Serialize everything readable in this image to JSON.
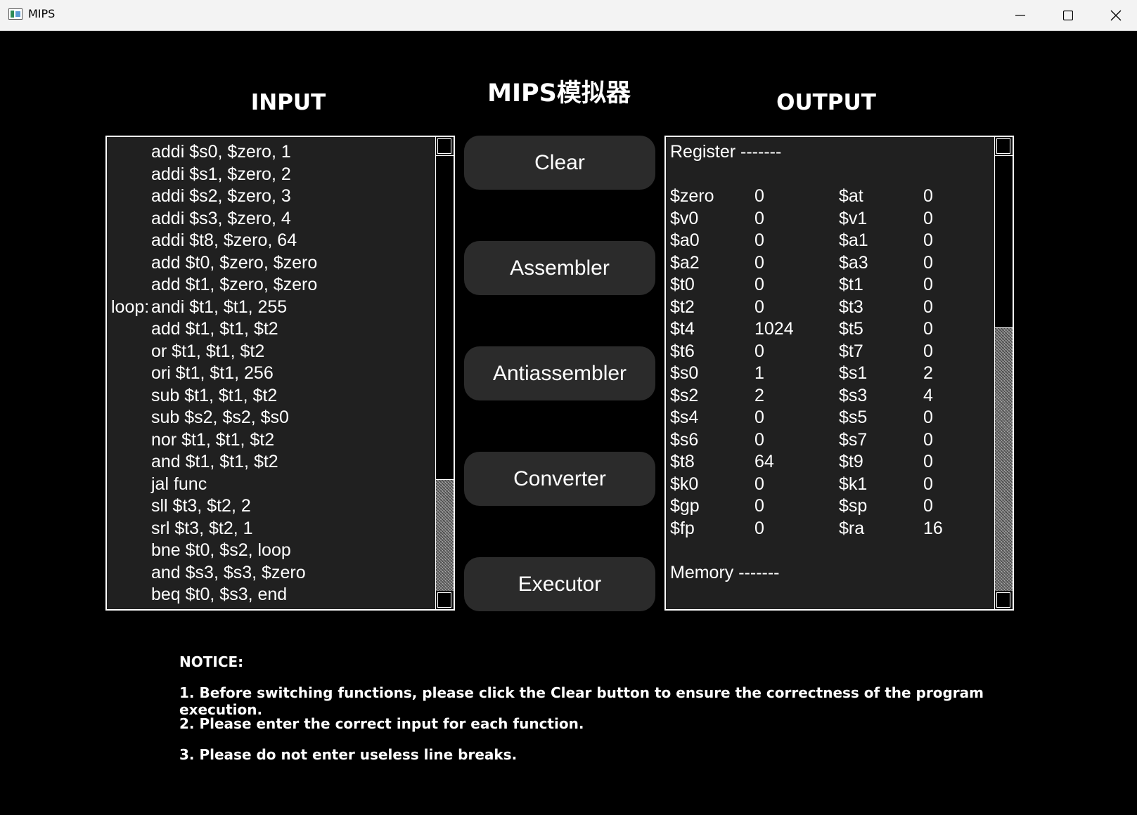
{
  "window": {
    "title": "MIPS"
  },
  "headings": {
    "input": "INPUT",
    "output": "OUTPUT",
    "main": "MIPS模拟器"
  },
  "input_lines": [
    {
      "label": "",
      "code": "addi $s0, $zero, 1"
    },
    {
      "label": "",
      "code": "addi $s1, $zero, 2"
    },
    {
      "label": "",
      "code": "addi $s2, $zero, 3"
    },
    {
      "label": "",
      "code": "addi $s3, $zero, 4"
    },
    {
      "label": "",
      "code": "addi $t8, $zero, 64"
    },
    {
      "label": "",
      "code": "add $t0, $zero, $zero"
    },
    {
      "label": "",
      "code": "add $t1, $zero, $zero"
    },
    {
      "label": "loop:",
      "code": "andi $t1, $t1, 255"
    },
    {
      "label": "",
      "code": "add $t1, $t1, $t2"
    },
    {
      "label": "",
      "code": "or $t1, $t1, $t2"
    },
    {
      "label": "",
      "code": "ori $t1, $t1, 256"
    },
    {
      "label": "",
      "code": "sub $t1, $t1, $t2"
    },
    {
      "label": "",
      "code": "sub $s2, $s2, $s0"
    },
    {
      "label": "",
      "code": "nor $t1, $t1, $t2"
    },
    {
      "label": "",
      "code": "and $t1, $t1, $t2"
    },
    {
      "label": "",
      "code": "jal func"
    },
    {
      "label": "",
      "code": "sll $t3, $t2, 2"
    },
    {
      "label": "",
      "code": "srl $t3, $t2, 1"
    },
    {
      "label": "",
      "code": "bne $t0, $s2, loop"
    },
    {
      "label": "",
      "code": "and $s3, $s3, $zero"
    },
    {
      "label": "",
      "code": "beq $t0, $s3, end"
    }
  ],
  "buttons": {
    "clear": "Clear",
    "assembler": "Assembler",
    "antiassembler": "Antiassembler",
    "converter": "Converter",
    "executor": "Executor"
  },
  "output": {
    "register_header": "Register -------",
    "memory_header": "Memory -------",
    "registers": [
      [
        "$zero",
        "0",
        "$at",
        "0"
      ],
      [
        "$v0",
        "0",
        "$v1",
        "0"
      ],
      [
        "$a0",
        "0",
        "$a1",
        "0"
      ],
      [
        "$a2",
        "0",
        "$a3",
        "0"
      ],
      [
        "$t0",
        "0",
        "$t1",
        "0"
      ],
      [
        "$t2",
        "0",
        "$t3",
        "0"
      ],
      [
        "$t4",
        "1024",
        "$t5",
        "0"
      ],
      [
        "$t6",
        "0",
        "$t7",
        "0"
      ],
      [
        "$s0",
        "1",
        "$s1",
        "2"
      ],
      [
        "$s2",
        "2",
        "$s3",
        "4"
      ],
      [
        "$s4",
        "0",
        "$s5",
        "0"
      ],
      [
        "$s6",
        "0",
        "$s7",
        "0"
      ],
      [
        "$t8",
        "64",
        "$t9",
        "0"
      ],
      [
        "$k0",
        "0",
        "$k1",
        "0"
      ],
      [
        "$gp",
        "0",
        "$sp",
        "0"
      ],
      [
        "$fp",
        "0",
        "$ra",
        "16"
      ]
    ]
  },
  "notice": {
    "title": "NOTICE:",
    "items": [
      "1. Before switching functions, please click the Clear button to ensure the correctness of the program execution.",
      "2. Please enter the correct input for each function.",
      "3. Please do not enter useless line breaks."
    ]
  }
}
